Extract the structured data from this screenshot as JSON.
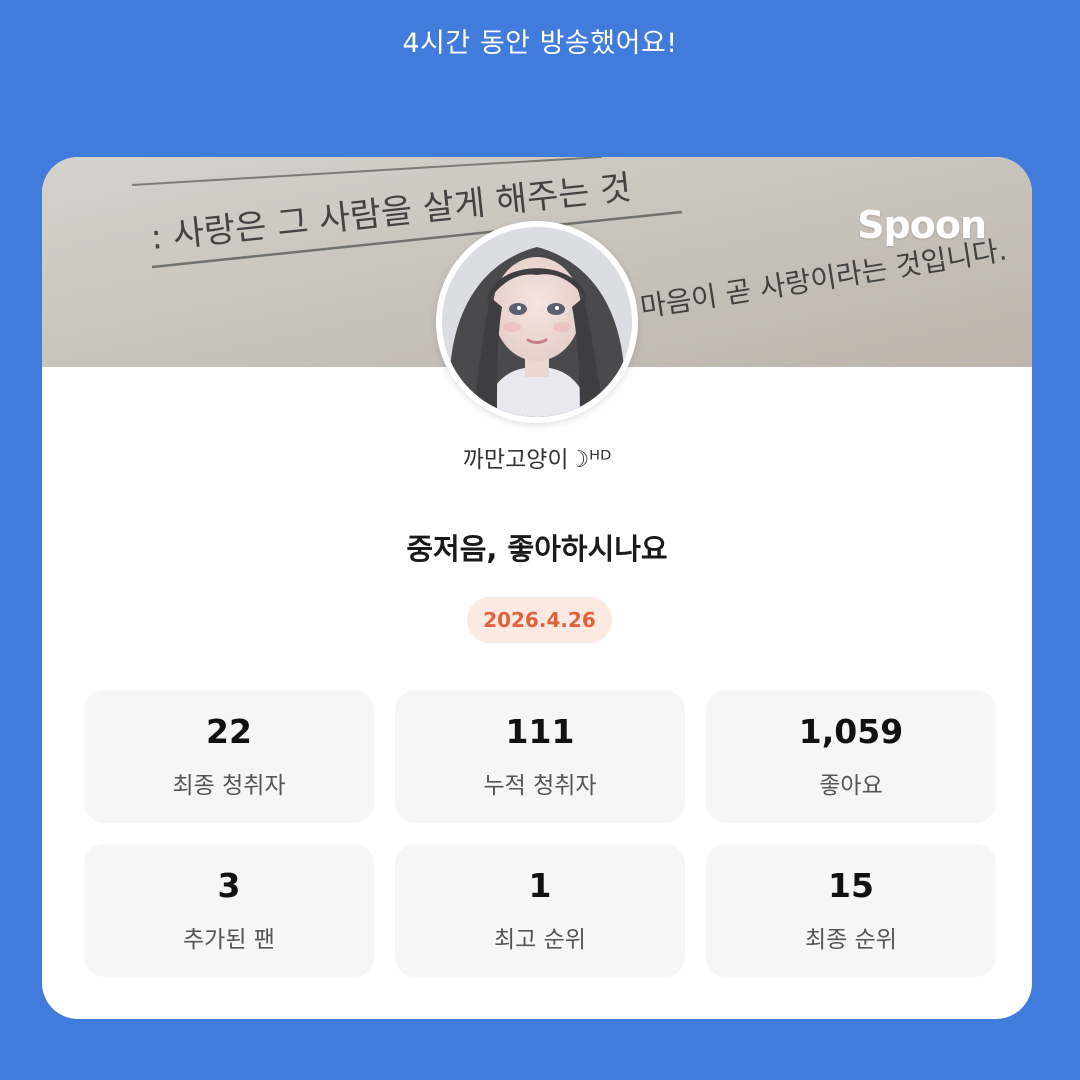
{
  "header": {
    "headline": "4시간 동안 방송했어요!"
  },
  "banner": {
    "brand": "Spoon",
    "background_text": [
      ": 사랑은 그 사람을 살게 해주는 것",
      "마음이 곧 사랑이라는 것입니다."
    ]
  },
  "profile": {
    "nickname": "까만고양이☽ᴴᴰ",
    "avatar_icon": "profile-avatar-illustration"
  },
  "broadcast": {
    "title": "중저음, 좋아하시나요",
    "date": "2026.4.26"
  },
  "stats": [
    {
      "value": "22",
      "label": "최종 청취자"
    },
    {
      "value": "111",
      "label": "누적 청취자"
    },
    {
      "value": "1,059",
      "label": "좋아요"
    },
    {
      "value": "3",
      "label": "추가된 팬"
    },
    {
      "value": "1",
      "label": "최고 순위"
    },
    {
      "value": "15",
      "label": "최종 순위"
    }
  ],
  "colors": {
    "background": "#417bdc",
    "card": "#ffffff",
    "badge_bg": "#fce9e2",
    "badge_text": "#e0633c",
    "stat_bg": "#f6f6f7"
  }
}
